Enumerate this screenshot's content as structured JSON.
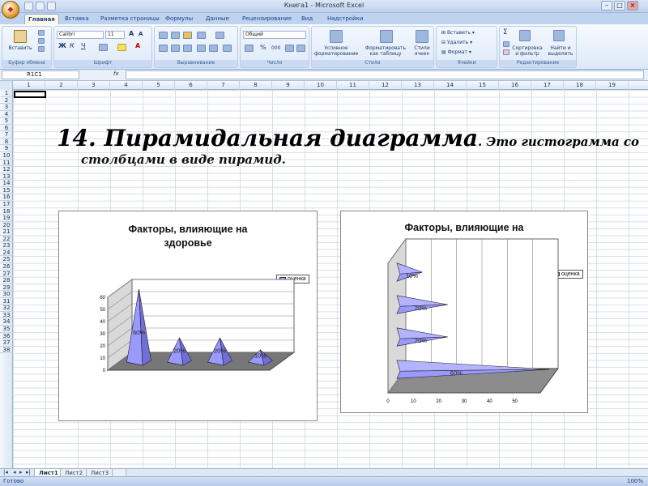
{
  "window": {
    "title": "Книга1 - Microsoft Excel"
  },
  "ribbon": {
    "tabs": [
      "Главная",
      "Вставка",
      "Разметка страницы",
      "Формулы",
      "Данные",
      "Рецензирование",
      "Вид",
      "Надстройки"
    ],
    "clipboard": {
      "paste": "Вставить",
      "label": "Буфер обмена"
    },
    "font": {
      "name": "Calibri",
      "size": "11",
      "label": "Шрифт"
    },
    "alignment": {
      "label": "Выравнивание"
    },
    "number": {
      "format": "Общий",
      "label": "Число"
    },
    "styles": {
      "conditional": "Условное форматирование",
      "table": "Форматировать как таблицу",
      "cell_styles": "Стили ячеек",
      "label": "Стили"
    },
    "cells": {
      "insert": "Вставить",
      "delete": "Удалить",
      "format": "Формат",
      "label": "Ячейки"
    },
    "editing": {
      "sort": "Сортировка и фильтр",
      "find": "Найти и выделить",
      "label": "Редактирование"
    }
  },
  "formula_bar": {
    "name_box": "R1C1",
    "fx": "fx"
  },
  "sheet": {
    "columns": [
      "1",
      "2",
      "3",
      "4",
      "5",
      "6",
      "7",
      "8",
      "9",
      "10",
      "11",
      "12",
      "13",
      "14",
      "15",
      "16",
      "17",
      "18",
      "19"
    ],
    "rows": [
      "1",
      "2",
      "3",
      "4",
      "5",
      "6",
      "7",
      "8",
      "9",
      "10",
      "11",
      "12",
      "13",
      "14",
      "15",
      "16",
      "17",
      "18",
      "19",
      "20",
      "21",
      "22",
      "23",
      "24",
      "25",
      "26",
      "27",
      "28",
      "29",
      "30",
      "31",
      "32",
      "33",
      "34",
      "35",
      "36",
      "37",
      "38"
    ]
  },
  "heading": {
    "strong": "14. Пирамидальная диаграмма",
    "rest": ". Это гистограмма со",
    "line2": "столбцами в виде пирамид."
  },
  "chart_data": [
    {
      "type": "bar",
      "title": "Факторы, влияющие на здоровье",
      "orientation": "vertical",
      "shape": "pyramid-3d",
      "series": [
        {
          "name": "оценка",
          "values": [
            60,
            20,
            20,
            10
          ]
        }
      ],
      "data_labels": [
        "60%",
        "20%",
        "20%",
        "10%"
      ],
      "ylim": [
        0,
        60
      ],
      "yticks": [
        "0",
        "10",
        "20",
        "30",
        "40",
        "50",
        "60"
      ],
      "legend": "top-right"
    },
    {
      "type": "bar",
      "title": "Факторы, влияющие на здоровье",
      "orientation": "horizontal",
      "shape": "pyramid-3d",
      "series": [
        {
          "name": "оценка",
          "values": [
            10,
            20,
            20,
            60
          ]
        }
      ],
      "data_labels": [
        "10%",
        "20%",
        "20%",
        "60%"
      ],
      "xlim": [
        0,
        60
      ],
      "xticks": [
        "0",
        "10",
        "20",
        "30",
        "40",
        "50"
      ],
      "legend": "top-right"
    }
  ],
  "sheet_tabs": [
    "Лист1",
    "Лист2",
    "Лист3"
  ],
  "status": {
    "text": "Готово",
    "zoom": "100%"
  },
  "colors": {
    "bar": "#9999ff",
    "ribbon": "#dce8f8",
    "plot_bg": "#d9d9d9"
  }
}
